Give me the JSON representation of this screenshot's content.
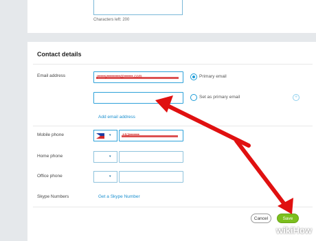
{
  "about": {
    "characters_left": "Characters left: 200"
  },
  "contact": {
    "title": "Contact details",
    "email": {
      "label": "Email address",
      "value": "j•••••y•••••••••@••••••.com",
      "primary_label": "Primary email",
      "set_primary_label": "Set as primary email",
      "add_link": "Add email address",
      "add_icon": "plus-circle-icon"
    },
    "mobile": {
      "label": "Mobile phone",
      "value": "+63•••••••",
      "caret": "▾"
    },
    "home": {
      "label": "Home phone",
      "caret": "▾"
    },
    "office": {
      "label": "Office phone",
      "caret": "▾"
    },
    "skype": {
      "label": "Skype Numbers",
      "link": "Get a Skype Number"
    }
  },
  "actions": {
    "cancel": "Cancel",
    "save": "Save"
  },
  "watermark": "wikiHow",
  "colors": {
    "accent": "#2da1d9",
    "save": "#7cbf1e",
    "arrow": "#e01010"
  }
}
